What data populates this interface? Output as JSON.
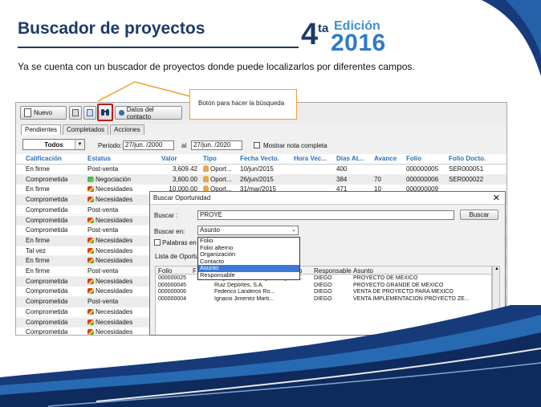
{
  "slide": {
    "title": "Buscador de proyectos",
    "edition_number": "4",
    "edition_sup": "ta",
    "edition_word": "Edición",
    "edition_year": "2016",
    "intro": "Ya se cuenta con un buscador de proyectos donde puede localizarlos por diferentes campos.",
    "callout": "Botón para hacer la búsqueda"
  },
  "toolbar": {
    "new_label": "Nuevo",
    "contact_label": "Datos del contacto"
  },
  "tabs": [
    "Pendientes",
    "Completados",
    "Acciones"
  ],
  "filter": {
    "scope": "Todos",
    "period_label": "Periodo:",
    "from": "27/jun. /2000",
    "to_label": "al",
    "to": "27/jun. /2020",
    "show_all": "Mostrar nota completa"
  },
  "columns": [
    "Calificación",
    "Estatus",
    "Valor",
    "Tipo",
    "Fecha Vecto.",
    "Hora Vec...",
    "Días At...",
    "Avance",
    "Folio",
    "Folio Docto."
  ],
  "rows": [
    {
      "cal": "En firme",
      "est": "Post-venta",
      "icon": "",
      "valor": "3,609.42",
      "tipo": "Oport...",
      "fecha": "10/jun/2015",
      "dias": "400",
      "avance": "",
      "folio": "000000005",
      "docto": "SER000051"
    },
    {
      "cal": "Comprometida",
      "est": "Negociación",
      "icon": "green",
      "valor": "3,600.00",
      "tipo": "Oport...",
      "fecha": "26/jun/2015",
      "dias": "384",
      "avance": "70",
      "folio": "000000006",
      "docto": "SER000022"
    },
    {
      "cal": "En firme",
      "est": "Necesidades",
      "icon": "multi",
      "valor": "10,000.00",
      "tipo": "Oport...",
      "fecha": "31/mar/2015",
      "dias": "471",
      "avance": "10",
      "folio": "000000009",
      "docto": ""
    },
    {
      "cal": "Comprometida",
      "est": "Necesidades",
      "icon": "multi"
    },
    {
      "cal": "Comprometida",
      "est": "Post-venta",
      "icon": ""
    },
    {
      "cal": "Comprometida",
      "est": "Necesidades",
      "icon": "multi"
    },
    {
      "cal": "Comprometida",
      "est": "Post-venta",
      "icon": ""
    },
    {
      "cal": "En firme",
      "est": "Necesidades",
      "icon": "multi"
    },
    {
      "cal": "Tal vez",
      "est": "Necesidades",
      "icon": "multi"
    },
    {
      "cal": "En firme",
      "est": "Necesidades",
      "icon": "multi"
    },
    {
      "cal": "En firme",
      "est": "Post-venta",
      "icon": ""
    },
    {
      "cal": "Comprometida",
      "est": "Necesidades",
      "icon": "multi"
    },
    {
      "cal": "Comprometida",
      "est": "Necesidades",
      "icon": "multi"
    },
    {
      "cal": "Comprometida",
      "est": "Post-venta",
      "icon": ""
    },
    {
      "cal": "Comprometida",
      "est": "Necesidades",
      "icon": "multi"
    },
    {
      "cal": "Comprometida",
      "est": "Necesidades",
      "icon": "multi"
    },
    {
      "cal": "Comprometida",
      "est": "Necesidades",
      "icon": "multi"
    }
  ],
  "dialog": {
    "title": "Buscar Oportunidad",
    "buscar_label": "Buscar :",
    "buscar_value": "PROYE",
    "buscar_button": "Buscar",
    "en_label": "Buscar en:",
    "en_value": "Asunto",
    "palabras_label": "Palabras en c",
    "lista_label": "Lista de Oportun",
    "options": [
      "Folio",
      "Folio alterno",
      "Organización",
      "Contacto",
      "Asunto",
      "Responsable"
    ],
    "selected_option": "Asunto",
    "res_columns": [
      "Folio",
      "F",
      "o",
      "Responsable",
      "Asunto"
    ],
    "results": [
      {
        "folio": "000000025",
        "org": "Jorge Velasco Noriega",
        "contacto": "Jorge Ve...",
        "resp": "DIEGO",
        "asunto": "PROYECTO DE MEXICO"
      },
      {
        "folio": "000000045",
        "org": "Ruiz Deportes, S.A.",
        "contacto": "",
        "resp": "DIEGO",
        "asunto": "PROYECTO GRANDE DE MEXICO"
      },
      {
        "folio": "000000006",
        "org": "Federico Landeros Ro...",
        "contacto": "",
        "resp": "DIEGO",
        "asunto": "VENTA DE PROYECTO PARA MEXICO"
      },
      {
        "folio": "000000004",
        "org": "Ignacio Jimenez Marti...",
        "contacto": "",
        "resp": "DIEGO",
        "asunto": "VENTA IMPLEMENTACION PROYECTO ZE..."
      }
    ]
  },
  "colors": {
    "title": "#1b3a6b",
    "accent": "#2e7bc6",
    "callout_border": "#f0a030",
    "active_button_border": "#c01818",
    "header_text": "#2d6fb8",
    "selected_option": "#3a7bd5"
  }
}
